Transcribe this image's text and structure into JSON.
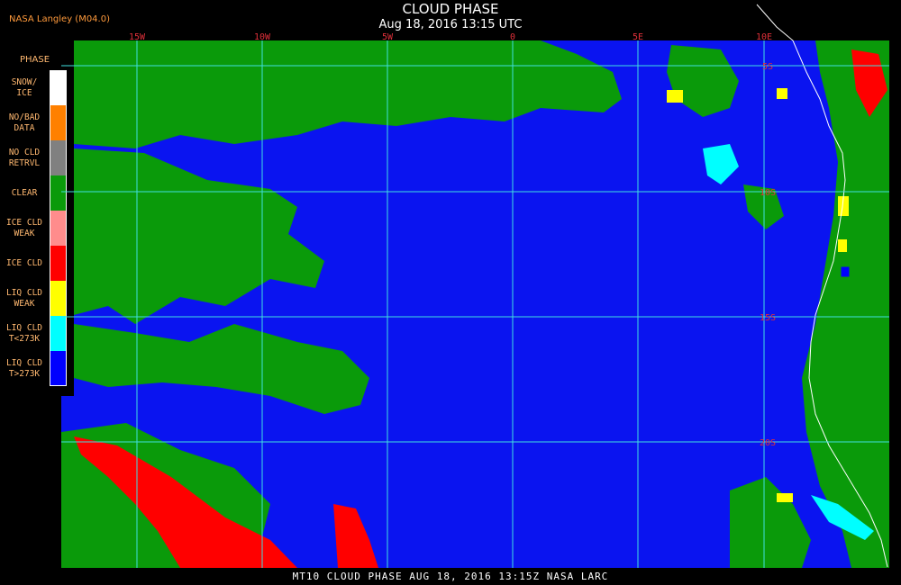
{
  "header": {
    "title": "CLOUD PHASE",
    "subtitle": "Aug 18, 2016 13:15 UTC",
    "source": "NASA Langley (M04.0)"
  },
  "legend": {
    "title": "PHASE",
    "items": [
      {
        "line1": "SNOW/",
        "line2": "ICE",
        "color": "#ffffff"
      },
      {
        "line1": "NO/BAD",
        "line2": "DATA",
        "color": "#ff8000"
      },
      {
        "line1": "NO CLD",
        "line2": "RETRVL",
        "color": "#808080"
      },
      {
        "line1": "CLEAR",
        "line2": "",
        "color": "#0a9a0a"
      },
      {
        "line1": "ICE CLD",
        "line2": "WEAK",
        "color": "#ff8c8c"
      },
      {
        "line1": "ICE CLD",
        "line2": "",
        "color": "#ff0000"
      },
      {
        "line1": "LIQ CLD",
        "line2": "WEAK",
        "color": "#ffff00"
      },
      {
        "line1": "LIQ CLD",
        "line2": "T<273K",
        "color": "#00ffff"
      },
      {
        "line1": "LIQ CLD",
        "line2": "T>273K",
        "color": "#0000ff"
      }
    ]
  },
  "map": {
    "lon_labels": [
      "15W",
      "10W",
      "5W",
      "0",
      "5E",
      "10E"
    ],
    "lat_labels": [
      "5S",
      "10S",
      "15S",
      "20S"
    ],
    "colors": {
      "liquid_warm": "#0a14f0",
      "clear": "#0a9a0a",
      "ice": "#ff0000",
      "liquid_cold": "#00ffff",
      "liquid_weak": "#ffff00",
      "grid": "#40e0e0",
      "coast": "#ffffff"
    }
  },
  "footer": {
    "text": "MT10  CLOUD PHASE  AUG 18, 2016 13:15Z  NASA LARC"
  }
}
